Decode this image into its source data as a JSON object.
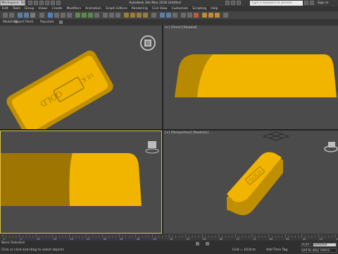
{
  "title_bar": {
    "workspace": "Workspace: Default",
    "app_title": "Autodesk 3ds Max 2016    Untitled",
    "search_placeholder": "Type a keyword or phrase",
    "sign_in": "Sign In"
  },
  "menu": [
    "Edit",
    "Tools",
    "Group",
    "Views",
    "Create",
    "Modifiers",
    "Animation",
    "Graph Editors",
    "Rendering",
    "Civil View",
    "Customize",
    "Scripting",
    "Help"
  ],
  "ribbon_row": {
    "left_label": "Modeling",
    "object_paint": "Object Paint",
    "populate": "Populate"
  },
  "viewports": {
    "top_left": {
      "label": "",
      "logo_text": "GOLD",
      "fineness": "18 K"
    },
    "top_right": {
      "label": "[+] [Front] [Shaded]"
    },
    "bottom_left": {
      "label": ""
    },
    "bottom_right": {
      "label": "[+] [Perspective] [Realistic]",
      "logo_text": "GOLD"
    }
  },
  "timeline": {
    "ticks": [
      "0",
      "5",
      "10",
      "15",
      "20",
      "25",
      "30",
      "35",
      "40",
      "45",
      "50",
      "55",
      "60",
      "65",
      "70",
      "75",
      "80",
      "85",
      "90",
      "95",
      "100"
    ]
  },
  "status": {
    "selection": "None Selected",
    "prompt": "Click or click-and-drag to select objects",
    "grid": "Grid = 10,0cm",
    "add_time_tag": "Add Time Tag",
    "auto_key": "Auto Key",
    "set_key": "Set Key",
    "selected": "Selected",
    "key_filters": "Key Filters..."
  },
  "colors": {
    "gold": "#f1b500",
    "gold_shadow": "#b88a00",
    "viewport_bg": "#4b4b4b",
    "active_border": "#e0c341"
  }
}
